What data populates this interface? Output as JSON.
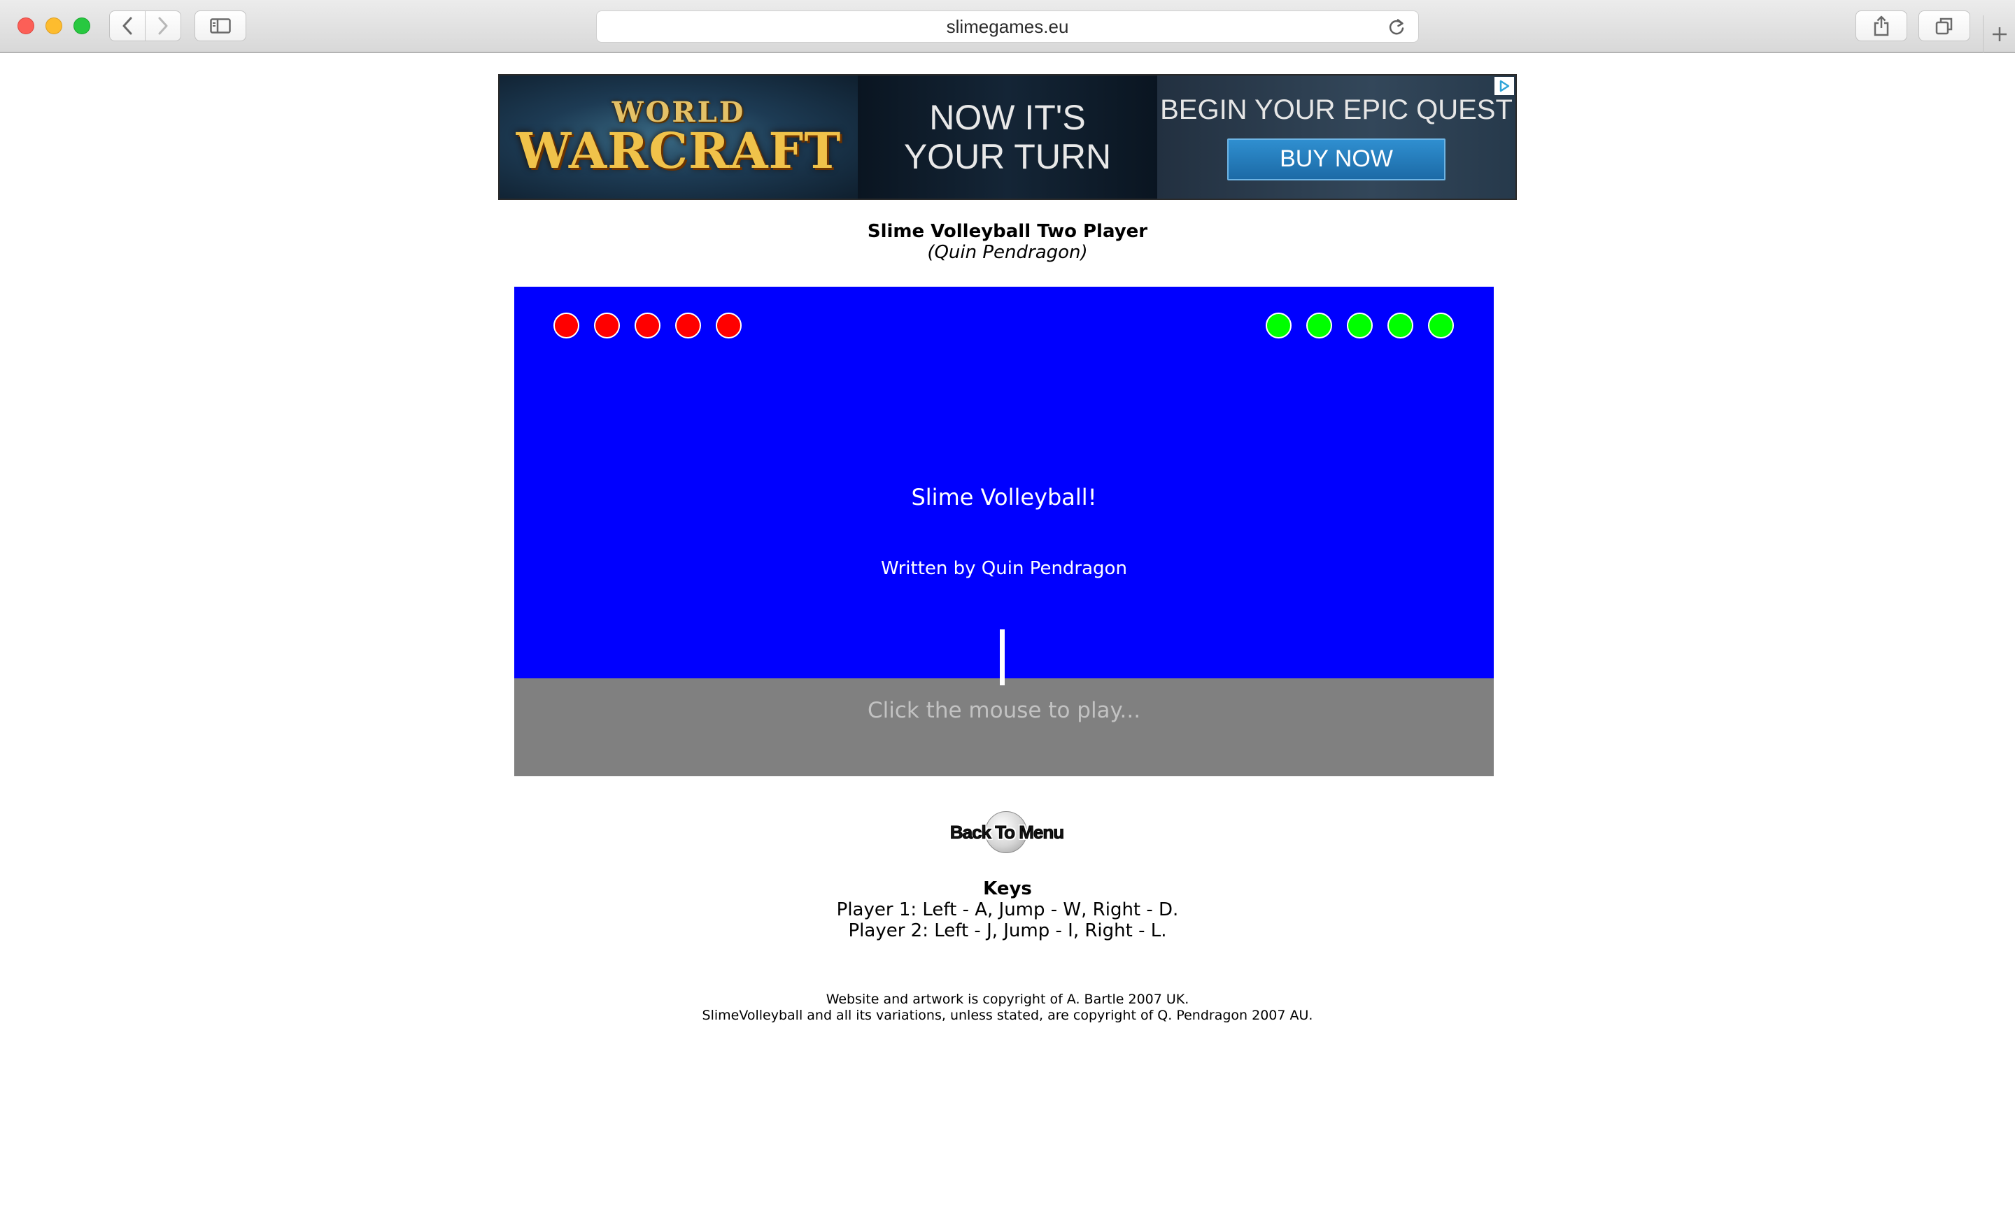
{
  "browser": {
    "url": "slimegames.eu",
    "icons": {
      "back": "chevron-left-icon",
      "forward": "chevron-right-icon",
      "sidebar": "sidebar-icon",
      "reload": "reload-icon",
      "share": "share-icon",
      "tabs": "tabs-overview-icon",
      "new_tab": "plus-icon"
    }
  },
  "ad": {
    "logo_top": "WORLD",
    "logo_main": "WARCRAFT",
    "tagline_line1": "NOW IT'S",
    "tagline_line2": "YOUR TURN",
    "quest": "BEGIN YOUR EPIC QUEST",
    "cta": "BUY NOW",
    "choices_icon": "adchoices-icon"
  },
  "page": {
    "title": "Slime Volleyball Two Player",
    "author": "(Quin Pendragon)"
  },
  "game": {
    "sky_color": "#0000ff",
    "ground_color": "#808080",
    "title": "Slime Volleyball!",
    "credit": "Written by Quin Pendragon",
    "prompt": "Click the mouse to play...",
    "player1_points_remaining": 5,
    "player2_points_remaining": 5,
    "player1_color": "#ff0000",
    "player2_color": "#00ff00"
  },
  "back_to_menu": "Back To Menu",
  "keys": {
    "title": "Keys",
    "player1": "Player 1: Left - A, Jump - W, Right - D.",
    "player2": "Player 2: Left - J, Jump - I, Right - L."
  },
  "footer": {
    "line1": "Website and artwork is copyright of A. Bartle 2007 UK.",
    "line2": "SlimeVolleyball and all its variations, unless stated, are copyright of Q. Pendragon 2007 AU."
  }
}
